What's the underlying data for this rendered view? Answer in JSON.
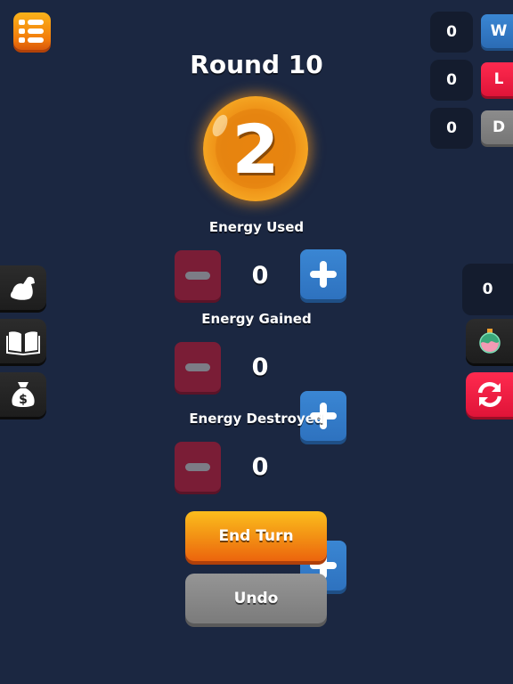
{
  "header": {
    "menu_icon": "list-menu-icon",
    "round_title": "Round 10",
    "coin_value": "2"
  },
  "record": [
    {
      "count": "0",
      "label": "W",
      "meaning": "wins",
      "color": "#2e72bf"
    },
    {
      "count": "0",
      "label": "L",
      "meaning": "losses",
      "color": "#e6193c"
    },
    {
      "count": "0",
      "label": "D",
      "meaning": "draws",
      "color": "#808080"
    }
  ],
  "counters": [
    {
      "label": "Energy Used",
      "value": "0"
    },
    {
      "label": "Energy Gained",
      "value": "0"
    },
    {
      "label": "Energy Destroyed",
      "value": "0"
    }
  ],
  "left_tools": [
    {
      "icon": "flexed-arm-icon"
    },
    {
      "icon": "open-book-icon"
    },
    {
      "icon": "money-bag-icon"
    }
  ],
  "right_panel": {
    "counter": "0",
    "potion_icon": "potion-icon",
    "refresh_icon": "refresh-icon"
  },
  "actions": {
    "end_turn": "End Turn",
    "undo": "Undo"
  },
  "colors": {
    "background": "#1b2741",
    "accent_orange": "#f39214",
    "plus_blue": "#2e72bf",
    "minus_maroon": "#7a1d36"
  }
}
